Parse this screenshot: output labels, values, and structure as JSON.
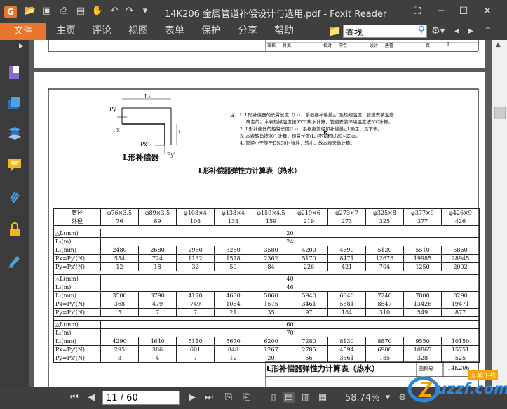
{
  "titlebar": {
    "title": "14K206 金属管道补偿设计与选用.pdf - Foxit Reader"
  },
  "menu": {
    "file": "文件",
    "items": [
      "主页",
      "评论",
      "视图",
      "表单",
      "保护",
      "分享",
      "帮助"
    ]
  },
  "search": {
    "value": "查找"
  },
  "status": {
    "page": "11 / 60",
    "zoom": "58.74%"
  },
  "prev_page": {
    "signature_row": [
      "审核",
      "肖武",
      "",
      "校对",
      "申会",
      "",
      "设计",
      "唐蕾",
      "",
      "页",
      "9"
    ]
  },
  "diagram": {
    "py": "Py",
    "px": "Px",
    "l2": "L₂",
    "l1": "L₁",
    "pxp": "Px'",
    "pyp": "Py'",
    "caption": "L形补偿器"
  },
  "notes": [
    "注：1. L形补偿器的长臂长度（L₂），系根据补偿量△L及热规温度、管道安装温度",
    "确定的。本表热媒温度按95℃热水计算，管道安装环境温度按5℃计算。",
    "2. L形补偿器的短臂长度(L₁)，系根据管径和补偿量△L确定，见下表。",
    "3. 本表转角按90° 计算，短臂长度(L₁)不宜超过20~25m。",
    "4. 管径小于等于DN50时弹性力较小，故本表未做计算。"
  ],
  "table": {
    "title": "L形补偿器弹性力计算表（热水）",
    "header_pipe": "管径",
    "header_od": "外径",
    "pipes": [
      "φ76×3.5",
      "φ89×3.5",
      "φ108×4",
      "φ133×4",
      "φ159×4.5",
      "φ219×6",
      "φ273×7",
      "φ325×8",
      "φ377×9",
      "φ426×9"
    ],
    "ods": [
      "76",
      "89",
      "108",
      "133",
      "159",
      "219",
      "273",
      "325",
      "377",
      "426"
    ],
    "groups": [
      {
        "dl_label": "△L(mm)",
        "dl": "20",
        "l2_label": "L₂(m)",
        "l2": "24",
        "rows": [
          {
            "label": "L₁(mm)",
            "values": [
              "2480",
              "2680",
              "2950",
              "3280",
              "3580",
              "4200",
              "4690",
              "5120",
              "5510",
              "5860"
            ]
          },
          {
            "label": "Px=Py'(N)",
            "values": [
              "554",
              "724",
              "1132",
              "1578",
              "2362",
              "5170",
              "8471",
              "12678",
              "19985",
              "28945"
            ]
          },
          {
            "label": "Py=Px'(N)",
            "values": [
              "12",
              "18",
              "32",
              "50",
              "84",
              "226",
              "421",
              "704",
              "1250",
              "2002"
            ]
          }
        ]
      },
      {
        "dl_label": "△L(mm)",
        "dl": "40",
        "l2_label": "L₂(m)",
        "l2": "46",
        "rows": [
          {
            "label": "L₁(mm)",
            "values": [
              "3500",
              "3790",
              "4170",
              "4630",
              "5060",
              "5940",
              "6640",
              "7240",
              "7800",
              "8290"
            ]
          },
          {
            "label": "Px=Py'(N)",
            "values": [
              "368",
              "479",
              "749",
              "1054",
              "1575",
              "3461",
              "5681",
              "8547",
              "13426",
              "19471"
            ]
          },
          {
            "label": "Py=Px'(N)",
            "values": [
              "5",
              "7",
              "7",
              "21",
              "35",
              "97",
              "184",
              "310",
              "549",
              "877"
            ]
          }
        ]
      },
      {
        "dl_label": "△L(mm)",
        "dl": "60",
        "l2_label": "L₂(m)",
        "l2": "70",
        "rows": [
          {
            "label": "L₁(mm)",
            "values": [
              "4290",
              "4640",
              "5110",
              "5670",
              "6200",
              "7280",
              "8130",
              "8870",
              "9550",
              "10150"
            ]
          },
          {
            "label": "Px=Py'(N)",
            "values": [
              "295",
              "386",
              "601",
              "848",
              "1267",
              "2785",
              "4594",
              "6908",
              "10865",
              "15751"
            ]
          },
          {
            "label": "Py=Px'(N)",
            "values": [
              "3",
              "4",
              "7",
              "12",
              "20",
              "56",
              "3861",
              "185",
              "328",
              "525"
            ]
          }
        ]
      }
    ]
  },
  "titleblock": {
    "title": "L形补偿器弹性力计算表（热水）",
    "atlas_label": "图集号",
    "atlas_no": "14K206"
  },
  "watermark": {
    "text": "uzzf.com",
    "tag": "东坡下载"
  }
}
